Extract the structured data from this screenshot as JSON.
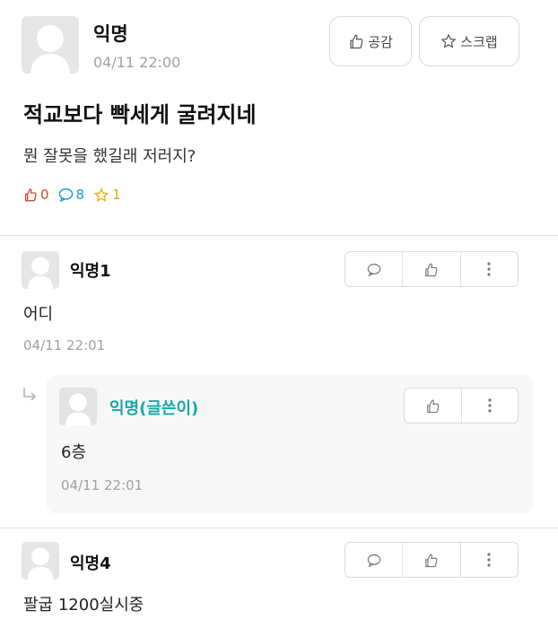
{
  "post": {
    "author": "익명",
    "time": "04/11 22:00",
    "title": "적교보다 빡세게 굴려지네",
    "body": "뭔 잘못을 했길래 저러지?",
    "like_label": "공감",
    "scrap_label": "스크랩",
    "like_count": "0",
    "comment_count": "8",
    "scrap_count": "1"
  },
  "comments": [
    {
      "author": "익명1",
      "text": "어디",
      "time": "04/11 22:01"
    },
    {
      "author": "익명4",
      "text": "팔굽 1200실시중"
    }
  ],
  "reply": {
    "author": "익명(글쓴이)",
    "text": "6층",
    "time": "04/11 22:01"
  },
  "colors": {
    "reply_author": "#1aa8a8",
    "comment_icon": "#1a9bd7",
    "like_icon": "#d54a2a",
    "star_icon": "#f0b400"
  }
}
